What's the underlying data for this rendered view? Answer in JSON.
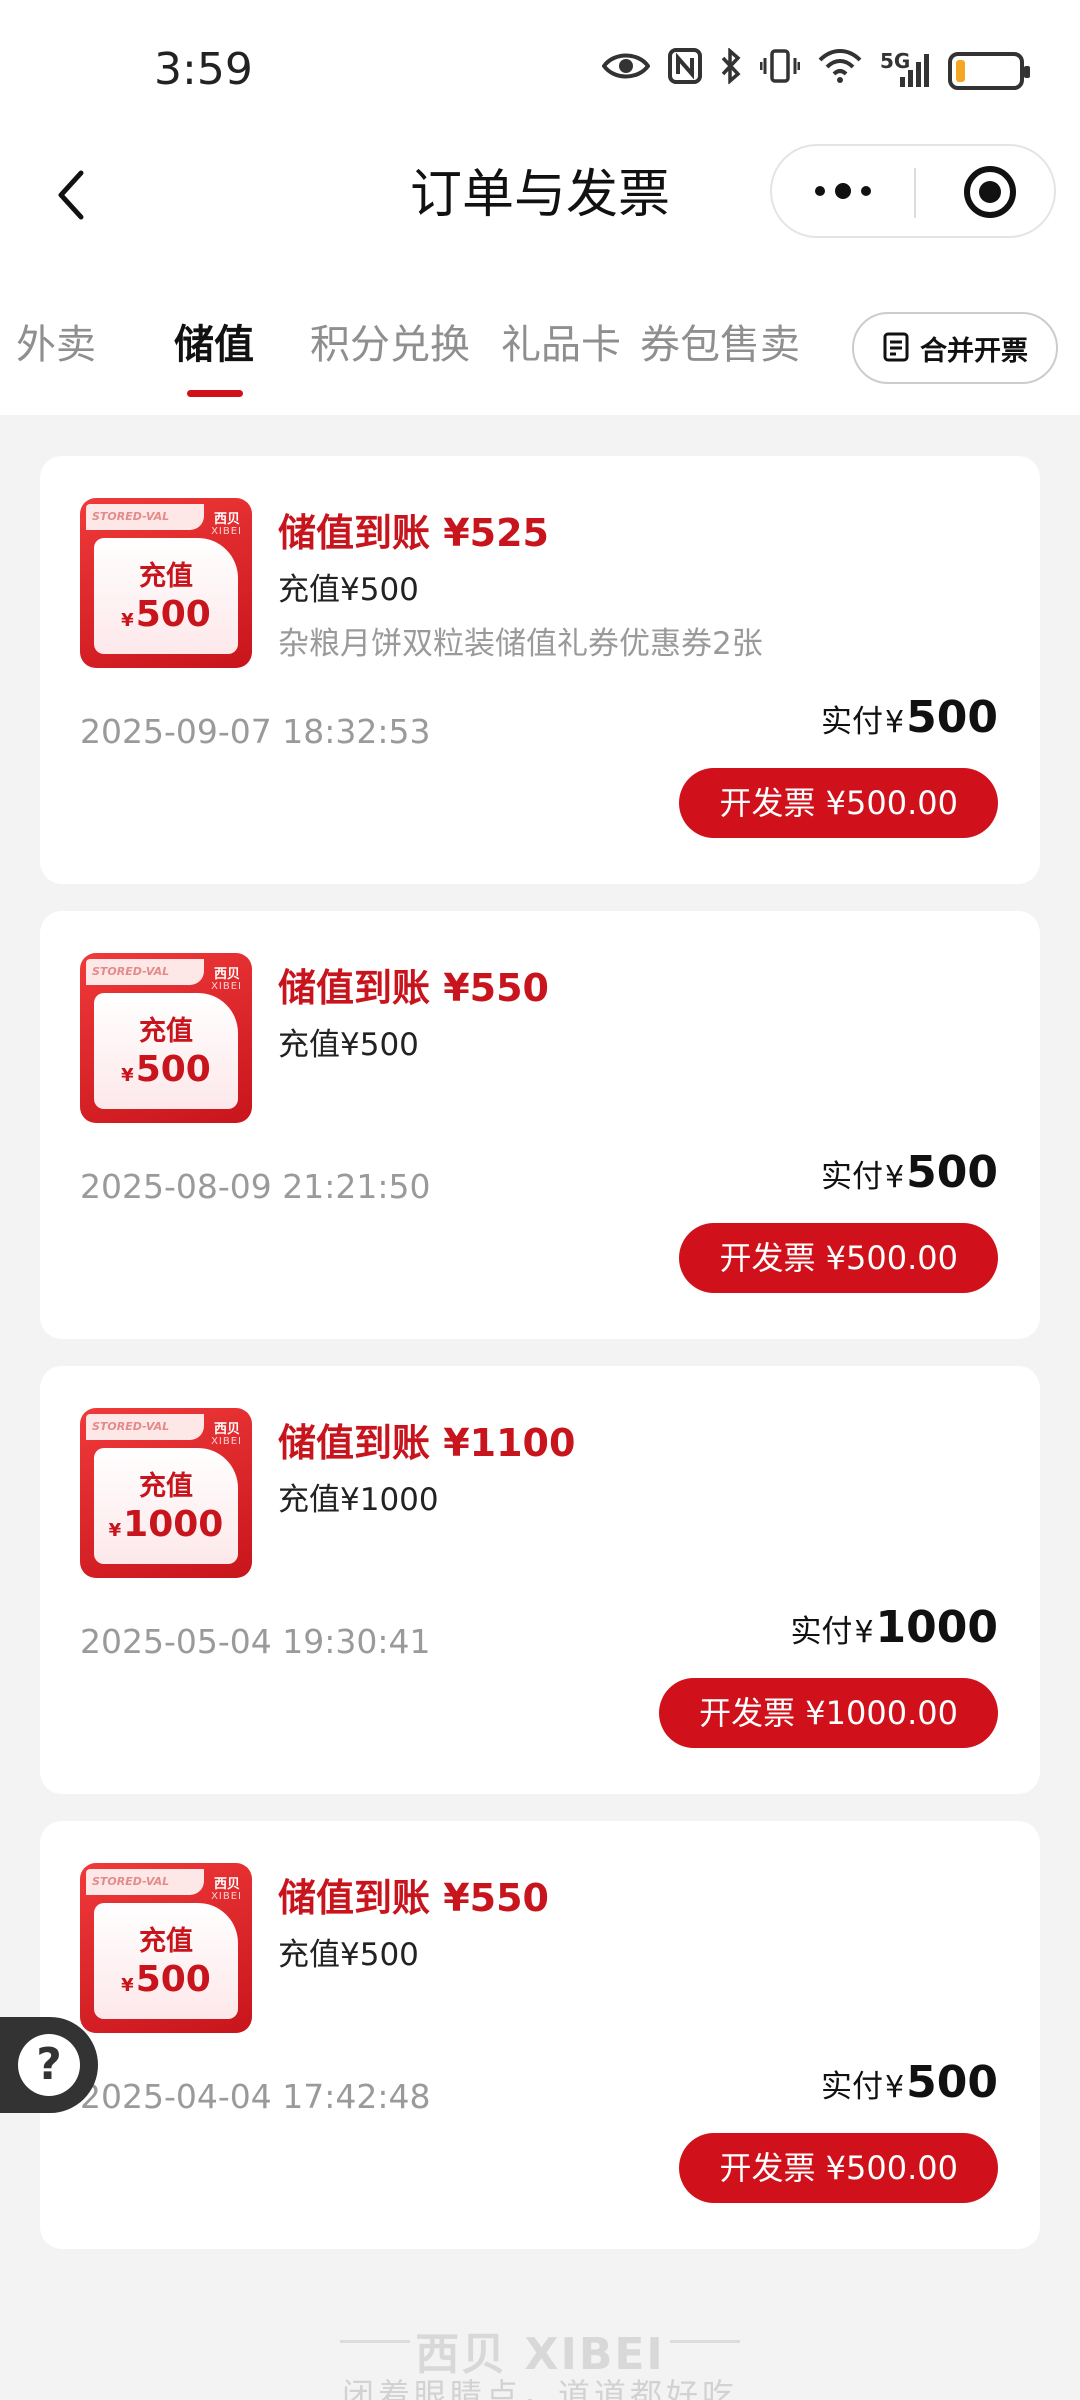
{
  "status_bar": {
    "time": "3:59",
    "icons": [
      "eye-icon",
      "nfc-icon",
      "bluetooth-icon",
      "vibrate-icon",
      "wifi-icon",
      "signal-5g-icon",
      "battery-icon"
    ],
    "network_label": "5G",
    "battery_level": 0.15,
    "battery_color": "#f5a623"
  },
  "nav": {
    "title": "订单与发票"
  },
  "tabs": [
    {
      "label": "外卖",
      "active": false
    },
    {
      "label": "储值",
      "active": true
    },
    {
      "label": "积分兑换",
      "active": false
    },
    {
      "label": "礼品卡",
      "active": false
    },
    {
      "label": "券包售卖",
      "active": false
    }
  ],
  "merge_button": {
    "label": "合并开票"
  },
  "orders": [
    {
      "title": "储值到账 ¥525",
      "subtitle": "充值¥500",
      "extra": "杂粮月饼双粒装储值礼券优惠券2张",
      "date": "2025-09-07 18:32:53",
      "paid_label": "实付",
      "currency": "¥",
      "paid_amount": "500",
      "invoice_button": "开发票 ¥500.00",
      "thumb": {
        "ribbon": "STORED-VAL",
        "brand_cn": "西贝",
        "brand_en": "XIBEI",
        "label": "充值",
        "currency": "¥",
        "amount": "500"
      }
    },
    {
      "title": "储值到账 ¥550",
      "subtitle": "充值¥500",
      "extra": "",
      "date": "2025-08-09 21:21:50",
      "paid_label": "实付",
      "currency": "¥",
      "paid_amount": "500",
      "invoice_button": "开发票 ¥500.00",
      "thumb": {
        "ribbon": "STORED-VAL",
        "brand_cn": "西贝",
        "brand_en": "XIBEI",
        "label": "充值",
        "currency": "¥",
        "amount": "500"
      }
    },
    {
      "title": "储值到账 ¥1100",
      "subtitle": "充值¥1000",
      "extra": "",
      "date": "2025-05-04 19:30:41",
      "paid_label": "实付",
      "currency": "¥",
      "paid_amount": "1000",
      "invoice_button": "开发票 ¥1000.00",
      "thumb": {
        "ribbon": "STORED-VAL",
        "brand_cn": "西贝",
        "brand_en": "XIBEI",
        "label": "充值",
        "currency": "¥",
        "amount": "1000"
      }
    },
    {
      "title": "储值到账 ¥550",
      "subtitle": "充值¥500",
      "extra": "",
      "date": "2025-04-04 17:42:48",
      "paid_label": "实付",
      "currency": "¥",
      "paid_amount": "500",
      "invoice_button": "开发票 ¥500.00",
      "thumb": {
        "ribbon": "STORED-VAL",
        "brand_cn": "西贝",
        "brand_en": "XIBEI",
        "label": "充值",
        "currency": "¥",
        "amount": "500"
      }
    }
  ],
  "help_float": {
    "icon": "question-icon",
    "glyph": "?"
  },
  "footer": {
    "brand": "西贝 XIBEI",
    "slogan": "闭着眼睛点，道道都好吃"
  },
  "colors": {
    "accent": "#d0101a",
    "background": "#f3f3f3",
    "muted_text": "#9a9a9a"
  }
}
